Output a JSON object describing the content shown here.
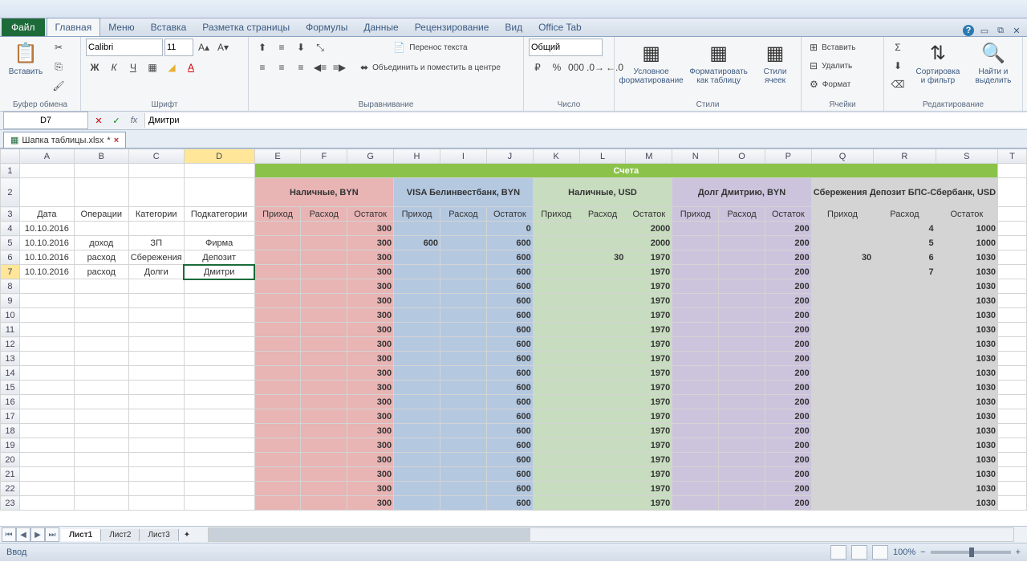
{
  "app": {
    "file_tab": "Файл"
  },
  "tabs": [
    "Главная",
    "Меню",
    "Вставка",
    "Разметка страницы",
    "Формулы",
    "Данные",
    "Рецензирование",
    "Вид",
    "Office Tab"
  ],
  "active_tab": 0,
  "ribbon": {
    "clipboard": {
      "label": "Буфер обмена",
      "paste": "Вставить"
    },
    "font": {
      "label": "Шрифт",
      "name": "Calibri",
      "size": "11"
    },
    "align": {
      "label": "Выравнивание",
      "wrap": "Перенос текста",
      "merge": "Объединить и поместить в центре"
    },
    "number": {
      "label": "Число",
      "format": "Общий"
    },
    "styles": {
      "label": "Стили",
      "cond": "Условное форматирование",
      "table": "Форматировать как таблицу",
      "cell": "Стили ячеек"
    },
    "cells": {
      "label": "Ячейки",
      "insert": "Вставить",
      "delete": "Удалить",
      "format": "Формат"
    },
    "editing": {
      "label": "Редактирование",
      "sort": "Сортировка и фильтр",
      "find": "Найти и выделить"
    }
  },
  "namebox": "D7",
  "formula": "Дмитри",
  "doc_tab": "Шапка таблицы.xlsx",
  "columns": [
    "A",
    "B",
    "C",
    "D",
    "E",
    "F",
    "G",
    "H",
    "I",
    "J",
    "K",
    "L",
    "M",
    "N",
    "O",
    "P",
    "Q",
    "R",
    "S",
    "T"
  ],
  "accounts_title": "Счета",
  "account_groups": [
    "Наличные, BYN",
    "VISA Белинвестбанк, BYN",
    "Наличные, USD",
    "Долг Дмитрию, BYN",
    "Сбережения Депозит БПС-Сбербанк, USD"
  ],
  "subheaders_left": [
    "Дата",
    "Операции",
    "Категории",
    "Подкатегории"
  ],
  "subheaders_acc": [
    "Приход",
    "Расход",
    "Остаток"
  ],
  "rows": [
    {
      "r": 4,
      "a": "10.10.2016",
      "b": "",
      "c": "",
      "d": "",
      "g": "300",
      "h": "",
      "j": "0",
      "m": "2000",
      "p": "200",
      "q": "",
      "s": "1000"
    },
    {
      "r": 5,
      "a": "10.10.2016",
      "b": "доход",
      "c": "ЗП",
      "d": "Фирма",
      "g": "300",
      "h": "600",
      "j": "600",
      "m": "2000",
      "p": "200",
      "q": "",
      "s": "1000"
    },
    {
      "r": 6,
      "a": "10.10.2016",
      "b": "расход",
      "c": "Сбережения",
      "d": "Депозит",
      "g": "300",
      "h": "",
      "j": "600",
      "l": "30",
      "m": "1970",
      "p": "200",
      "q": "30",
      "s": "1030"
    },
    {
      "r": 7,
      "a": "10.10.2016",
      "b": "расход",
      "c": "Долги",
      "d": "Дмитри",
      "g": "300",
      "h": "",
      "j": "600",
      "m": "1970",
      "p": "200",
      "q": "",
      "s": "1030"
    }
  ],
  "empty_rows": [
    8,
    9,
    10,
    11,
    12,
    13,
    14,
    15,
    16,
    17,
    18,
    19,
    20,
    21,
    22,
    23
  ],
  "empty_vals": {
    "g": "300",
    "j": "600",
    "m": "1970",
    "p": "200",
    "s": "1030"
  },
  "sheets": [
    "Лист1",
    "Лист2",
    "Лист3"
  ],
  "status": "Ввод",
  "zoom": "100%"
}
